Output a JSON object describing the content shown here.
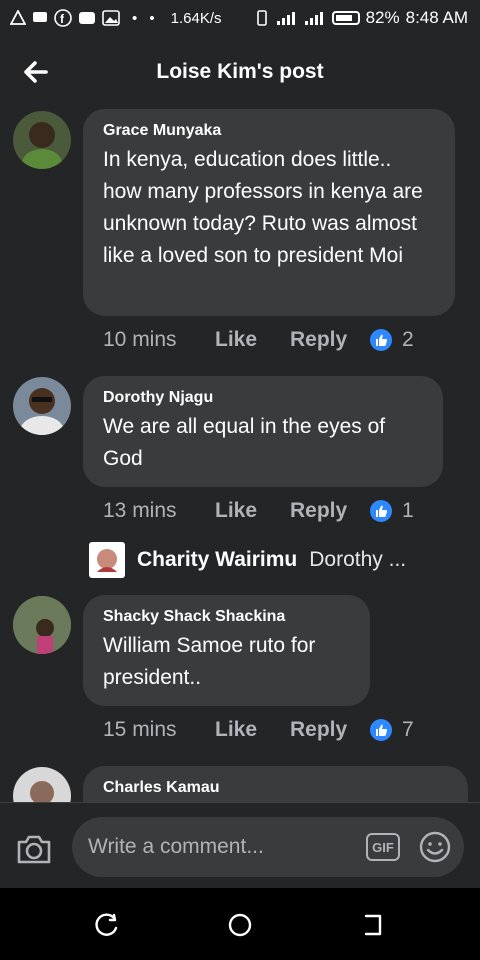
{
  "status_bar": {
    "speed": "1.64K/s",
    "battery": "82%",
    "time": "8:48 AM"
  },
  "header": {
    "title": "Loise Kim's post"
  },
  "comments": [
    {
      "author": "Grace Munyaka",
      "text": "In kenya, education does little.. how many professors in kenya are unknown today? Ruto was almost like a loved son to president Moi",
      "time": "10 mins",
      "like_label": "Like",
      "reply_label": "Reply",
      "reactions": "2"
    },
    {
      "author": "Dorothy Njagu",
      "text": "We are all equal in the eyes of God",
      "time": "13 mins",
      "like_label": "Like",
      "reply_label": "Reply",
      "reactions": "1"
    },
    {
      "author": "Shacky Shack Shackina",
      "text": "William Samoe ruto for president..",
      "time": "15 mins",
      "like_label": "Like",
      "reply_label": "Reply",
      "reactions": "7"
    },
    {
      "author": "Charles Kamau"
    }
  ],
  "reply_preview": {
    "author": "Charity Wairimu",
    "snippet": "Dorothy ..."
  },
  "composer": {
    "placeholder": "Write a comment...",
    "gif_label": "GIF"
  },
  "colors": {
    "background": "#242526",
    "bubble": "#3a3b3c",
    "like_blue": "#2e89ff",
    "meta_text": "#b0b3b8"
  }
}
